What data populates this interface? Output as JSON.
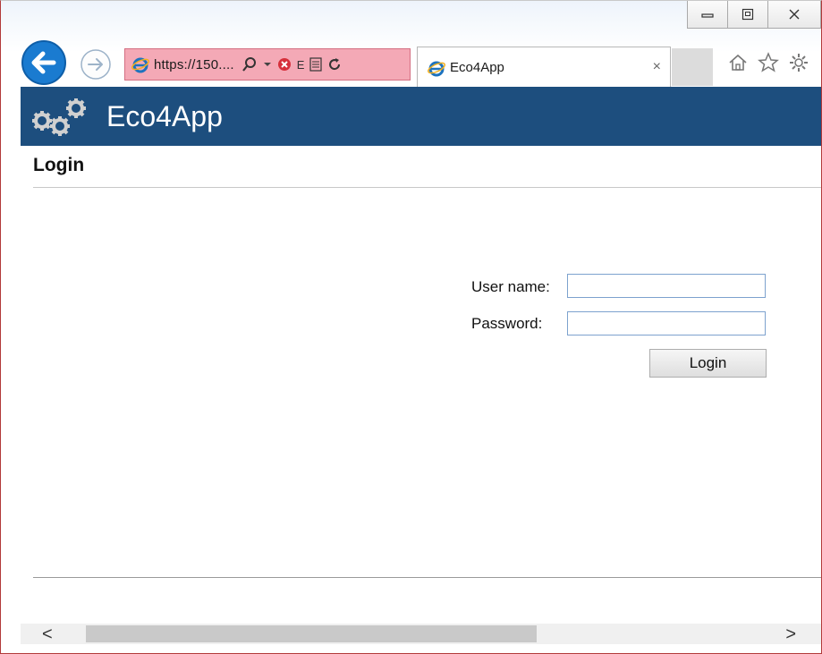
{
  "browser": {
    "address_url": "https://150....",
    "address_letter": "E",
    "tab_title": "Eco4App",
    "tab_close": "×",
    "window_buttons": {
      "minimize": "▭",
      "restore": "▣",
      "close": "✕"
    },
    "icons": [
      "back-arrow-icon",
      "forward-arrow-icon",
      "ie-logo-icon",
      "search-icon",
      "dropdown-icon",
      "error-icon",
      "compat-icon",
      "refresh-icon",
      "home-icon",
      "favorites-star-icon",
      "settings-gear-icon"
    ]
  },
  "app": {
    "title": "Eco4App",
    "brand_color": "#1d4e7e",
    "icons": [
      "gears-logo-icon"
    ]
  },
  "page": {
    "title": "Login"
  },
  "form": {
    "username_label": "User name:",
    "username_value": "",
    "password_label": "Password:",
    "password_value": "",
    "login_button": "Login"
  },
  "scrollbar": {
    "left_arrow": "<",
    "right_arrow": ">"
  }
}
